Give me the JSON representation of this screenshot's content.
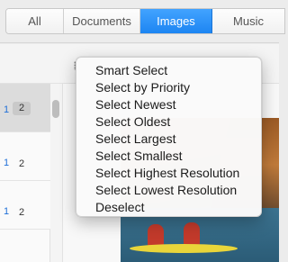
{
  "tabs": [
    {
      "label": "All",
      "active": false
    },
    {
      "label": "Documents",
      "active": false
    },
    {
      "label": "Images",
      "active": true
    },
    {
      "label": "Music",
      "active": false
    }
  ],
  "list": {
    "first_row": {
      "count_blue": "1",
      "count": "2"
    },
    "rows": [
      {
        "count_blue": "1",
        "count": "2",
        "selected": true
      },
      {
        "count_blue": "1",
        "count": "2",
        "selected": false
      },
      {
        "count_blue": "1",
        "count": "2",
        "selected": false
      }
    ]
  },
  "context_menu": {
    "items": [
      "Smart Select",
      "Select by Priority",
      "Select Newest",
      "Select Oldest",
      "Select Largest",
      "Select Smallest",
      "Select Highest Resolution",
      "Select Lowest Resolution",
      "Deselect"
    ]
  },
  "colors": {
    "accent": "#1d85f2",
    "count_blue": "#1f6fd8"
  }
}
